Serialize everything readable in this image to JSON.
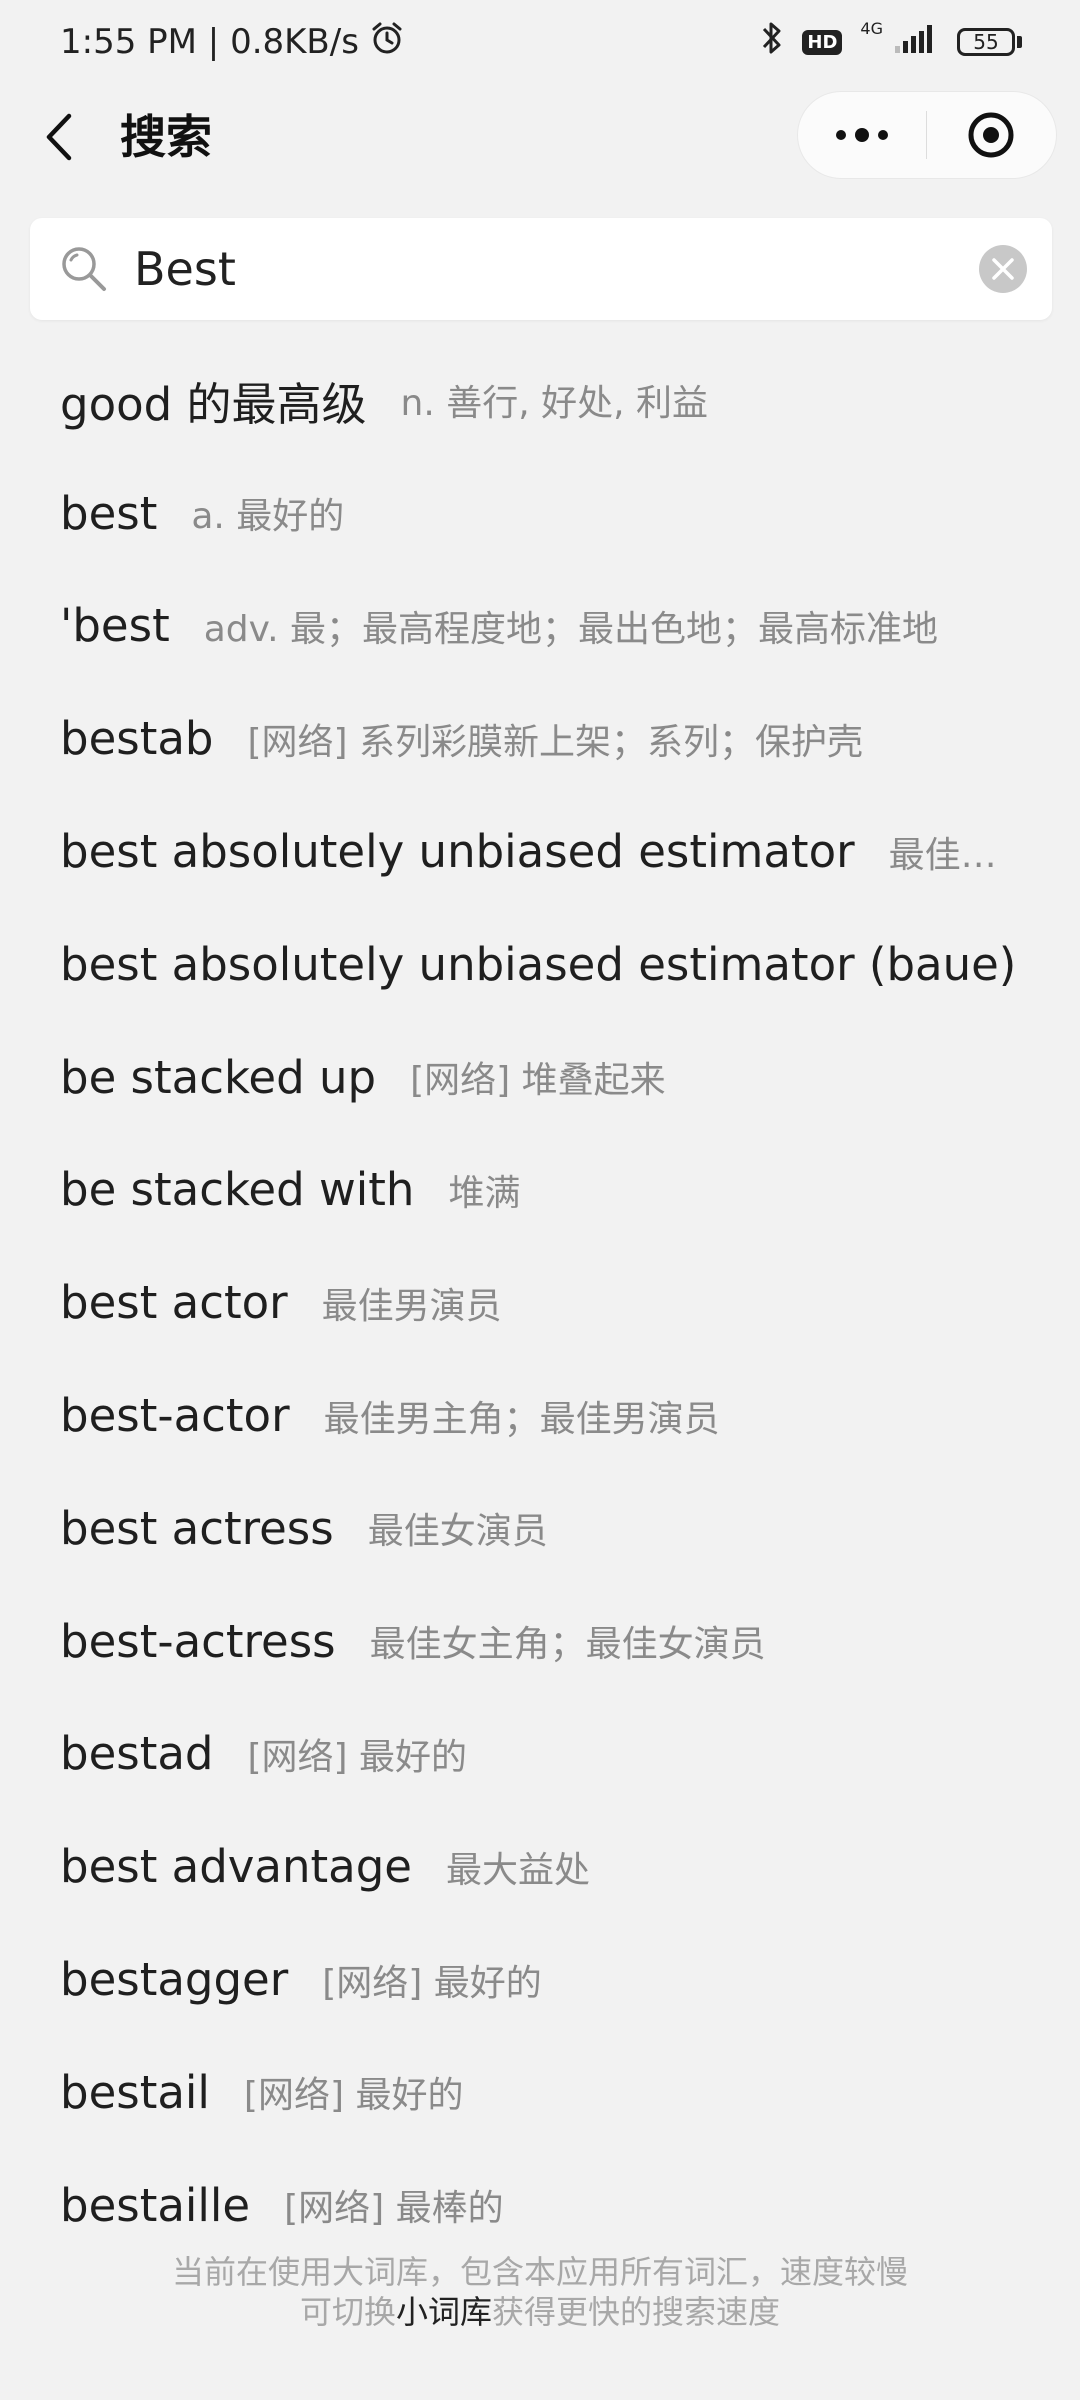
{
  "status_bar": {
    "time_text": "1:55 PM | 0.8KB/s",
    "hd_label": "HD",
    "network_label": "4G",
    "battery_level": "55"
  },
  "header": {
    "title": "搜索"
  },
  "search": {
    "value": "Best"
  },
  "results": [
    {
      "word": "good 的最高级",
      "definition": "n. 善行, 好处, 利益"
    },
    {
      "word": "best",
      "definition": "a. 最好的"
    },
    {
      "word": "'best",
      "definition": "adv. 最；最高程度地；最出色地；最高标准地"
    },
    {
      "word": "bestab",
      "definition": "[网络] 系列彩膜新上架；系列；保护壳"
    },
    {
      "word": "best absolutely unbiased estimator",
      "definition": "最佳绝对…"
    },
    {
      "word": "best absolutely unbiased estimator (baue)",
      "definition": "…"
    },
    {
      "word": "be stacked up",
      "definition": "[网络] 堆叠起来"
    },
    {
      "word": "be stacked with",
      "definition": "堆满"
    },
    {
      "word": "best actor",
      "definition": "最佳男演员"
    },
    {
      "word": "best-actor",
      "definition": "最佳男主角；最佳男演员"
    },
    {
      "word": "best actress",
      "definition": "最佳女演员"
    },
    {
      "word": "best-actress",
      "definition": "最佳女主角；最佳女演员"
    },
    {
      "word": "bestad",
      "definition": "[网络] 最好的"
    },
    {
      "word": "best advantage",
      "definition": "最大益处"
    },
    {
      "word": "bestagger",
      "definition": "[网络] 最好的"
    },
    {
      "word": "bestail",
      "definition": "[网络] 最好的"
    },
    {
      "word": "bestaille",
      "definition": "[网络] 最棒的"
    }
  ],
  "footer": {
    "line1": "当前在使用大词库，包含本应用所有词汇，速度较慢",
    "line2_prefix": "可切换",
    "line2_link": "小词库",
    "line2_suffix": "获得更快的搜索速度"
  }
}
